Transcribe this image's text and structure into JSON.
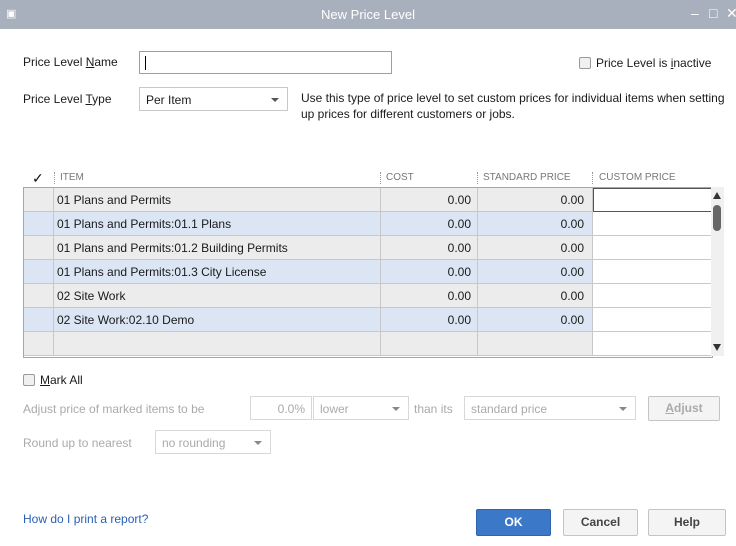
{
  "window": {
    "title": "New Price Level",
    "controls": [
      "–",
      "□",
      "✕"
    ]
  },
  "form": {
    "name_label_pre": "Price Level ",
    "name_label_key": "N",
    "name_label_post": "ame",
    "name_value": "",
    "inactive_label_pre": "Price Level is ",
    "inactive_label_key": "i",
    "inactive_label_post": "nactive",
    "type_label_pre": "Price Level ",
    "type_label_key": "T",
    "type_label_post": "ype",
    "type_value": "Per Item",
    "type_hint": "Use this type of price level to set custom prices for individual items when setting up prices for different customers or jobs."
  },
  "table": {
    "check_header": "✓",
    "headers": [
      "ITEM",
      "COST",
      "STANDARD PRICE",
      "CUSTOM PRICE"
    ],
    "rows": [
      {
        "item": "01 Plans and Permits",
        "cost": "0.00",
        "std": "0.00",
        "custom": ""
      },
      {
        "item": "01 Plans and Permits:01.1 Plans",
        "cost": "0.00",
        "std": "0.00",
        "custom": ""
      },
      {
        "item": "01 Plans and Permits:01.2 Building Permits",
        "cost": "0.00",
        "std": "0.00",
        "custom": ""
      },
      {
        "item": "01 Plans and Permits:01.3 City License",
        "cost": "0.00",
        "std": "0.00",
        "custom": ""
      },
      {
        "item": "02 Site Work",
        "cost": "0.00",
        "std": "0.00",
        "custom": ""
      },
      {
        "item": "02 Site Work:02.10 Demo",
        "cost": "0.00",
        "std": "0.00",
        "custom": ""
      },
      {
        "item": "",
        "cost": "",
        "std": "",
        "custom": ""
      }
    ]
  },
  "adjust": {
    "mark_all_key": "M",
    "mark_all_rest": "ark All",
    "adjust_label": "Adjust price of marked items to be",
    "percent": "0.0%",
    "direction": "lower",
    "than_its": "than its",
    "basis": "standard price",
    "adjust_btn_key": "A",
    "adjust_btn_rest": "djust",
    "round_label": "Round up to nearest",
    "rounding": "no rounding"
  },
  "footer": {
    "help_link": "How do I print a report?",
    "ok": "OK",
    "cancel": "Cancel",
    "help": "Help"
  },
  "colors": {
    "titlebar": "#a9b0bd",
    "row_blue": "#dbe5f3",
    "row_gray": "#ececec",
    "ok_button": "#3c78c8",
    "link": "#2b5fb4"
  }
}
